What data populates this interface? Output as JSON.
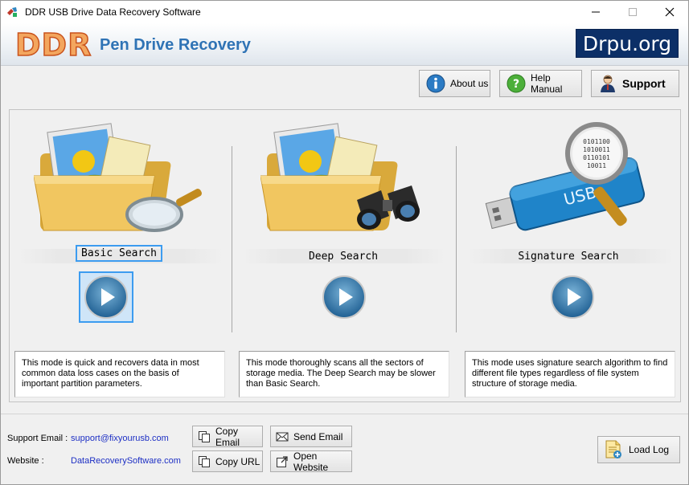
{
  "window": {
    "title": "DDR USB Drive Data Recovery Software"
  },
  "banner": {
    "logo_text": "DDR",
    "product_name": "Pen Drive Recovery",
    "site_badge": "Drpu.org"
  },
  "toolbar": {
    "about_label": "About us",
    "help_label": "Help Manual",
    "support_label": "Support"
  },
  "modes": [
    {
      "label": "Basic Search",
      "description": "This mode is quick and recovers data in most common data loss cases on the basis of important partition parameters.",
      "selected": true
    },
    {
      "label": "Deep Search",
      "description": "This mode thoroughly scans all the sectors of storage media. The Deep Search may be slower than Basic Search.",
      "selected": false
    },
    {
      "label": "Signature Search",
      "description": "This mode uses signature search algorithm to find different file types regardless of file system structure of storage media.",
      "selected": false
    }
  ],
  "footer": {
    "support_email_label": "Support Email :",
    "support_email": "support@fixyourusb.com",
    "website_label": "Website :",
    "website": "DataRecoverySoftware.com",
    "copy_email_label": "Copy Email",
    "send_email_label": "Send Email",
    "copy_url_label": "Copy URL",
    "open_website_label": "Open Website",
    "load_log_label": "Load Log"
  },
  "colors": {
    "accent_blue": "#2f73b5",
    "badge_navy": "#0c2f67",
    "logo_orange": "#f3a65e",
    "selection_blue": "#3c9cf0",
    "link_blue": "#1d2fc4"
  }
}
